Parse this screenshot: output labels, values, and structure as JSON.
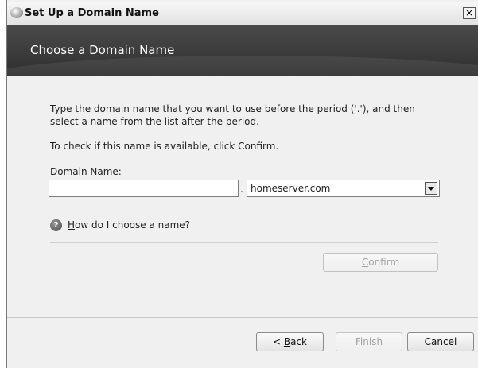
{
  "window": {
    "title": "Set Up a Domain Name"
  },
  "banner": {
    "title": "Choose a Domain Name"
  },
  "main": {
    "instruction": "Type the domain name that you want to use before the period ('.'), and then select a name from the list after the period.",
    "check_text": "To check if this name is available, click Confirm.",
    "domain_label": "Domain Name:",
    "domain_value": "",
    "period": ".",
    "suffix_value": "homeserver.com",
    "help_link_first": "H",
    "help_link_rest": "ow do I choose a name?",
    "confirm_first": "C",
    "confirm_rest": "onfirm"
  },
  "footer": {
    "back_prefix": "< ",
    "back_u": "B",
    "back_rest": "ack",
    "finish_label": "Finish",
    "cancel_label": "Cancel"
  },
  "icons": {
    "close": "×",
    "help": "?"
  }
}
